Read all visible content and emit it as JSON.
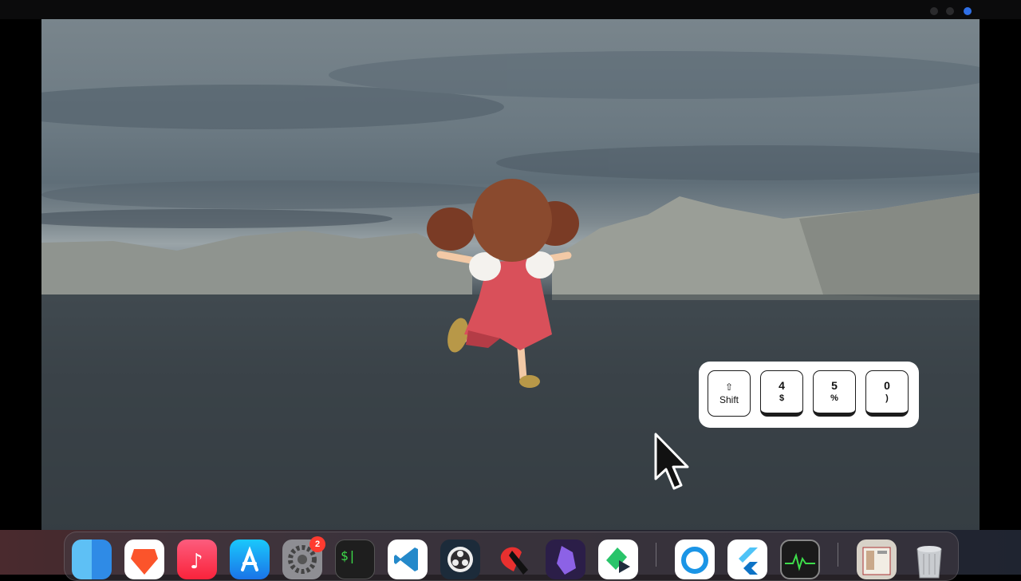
{
  "window": {
    "title": ""
  },
  "colors": {
    "key_border": "#1c1c1c",
    "badge": "#ff3b30",
    "dress": "#d9505a",
    "hair": "#7a3b25"
  },
  "keyboard_overlay": {
    "keys": [
      {
        "glyph": "⇧",
        "label": "Shift"
      },
      {
        "top": "4",
        "bottom": "$"
      },
      {
        "top": "5",
        "bottom": "%"
      },
      {
        "top": "0",
        "bottom": ")"
      }
    ]
  },
  "dock": {
    "apps": [
      {
        "name": "finder-icon"
      },
      {
        "name": "brave-browser-icon"
      },
      {
        "name": "music-icon"
      },
      {
        "name": "app-store-icon"
      },
      {
        "name": "system-settings-icon",
        "badge": "2"
      },
      {
        "name": "terminal-icon",
        "text": "$|"
      },
      {
        "name": "vscode-icon"
      },
      {
        "name": "obs-icon"
      },
      {
        "name": "app-red-icon"
      },
      {
        "name": "obsidian-icon"
      },
      {
        "name": "app-green-play-icon"
      },
      {
        "name": "app-blue-ring-icon"
      },
      {
        "name": "flutter-icon"
      },
      {
        "name": "activity-monitor-icon"
      },
      {
        "name": "document-viewer-icon"
      },
      {
        "name": "trash-icon"
      }
    ]
  }
}
